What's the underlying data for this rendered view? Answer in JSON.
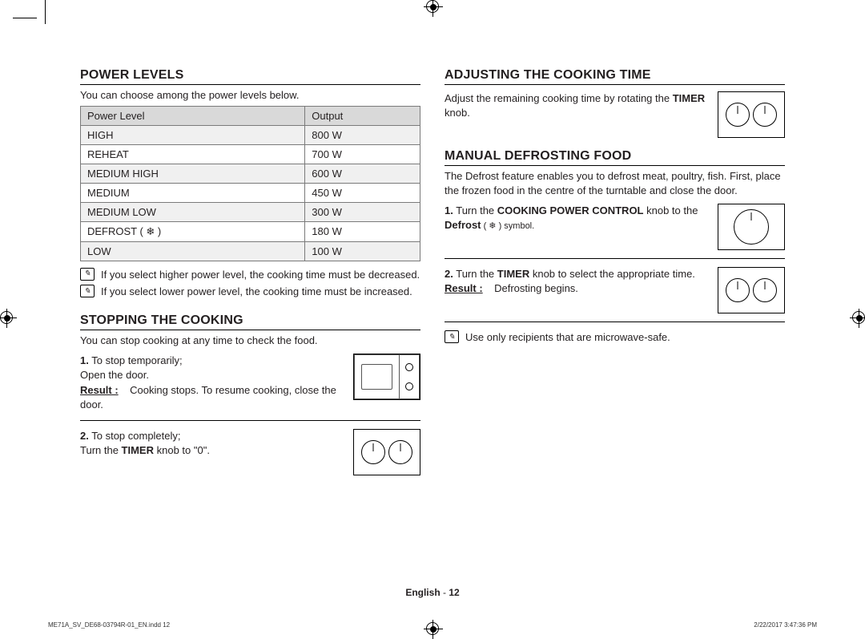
{
  "left": {
    "h_power": "POWER LEVELS",
    "power_intro": "You can choose among the power levels below.",
    "th_level": "Power Level",
    "th_output": "Output",
    "rows": [
      {
        "level": "HIGH",
        "out": "800 W"
      },
      {
        "level": "REHEAT",
        "out": "700 W"
      },
      {
        "level": "MEDIUM HIGH",
        "out": "600 W"
      },
      {
        "level": "MEDIUM",
        "out": "450 W"
      },
      {
        "level": "MEDIUM LOW",
        "out": "300 W"
      },
      {
        "level": "DEFROST ( ❄ )",
        "out": "180 W"
      },
      {
        "level": "LOW",
        "out": "100 W"
      }
    ],
    "note1": "If you select higher power level, the cooking time must be decreased.",
    "note2": "If you select lower power level, the cooking time must be increased.",
    "h_stop": "STOPPING THE COOKING",
    "stop_intro": "You can stop cooking at any time to check the food.",
    "stop1_num": "1.",
    "stop1_a": "To stop temporarily;",
    "stop1_b": "Open the door.",
    "result_label": "Result :",
    "stop1_res": "Cooking stops. To resume cooking, close the door.",
    "stop2_num": "2.",
    "stop2_a": "To stop completely;",
    "stop2_b_pre": "Turn the ",
    "stop2_b_bold": "TIMER",
    "stop2_b_post": " knob to \"0\"."
  },
  "right": {
    "h_adjust": "ADJUSTING THE COOKING TIME",
    "adjust_a": "Adjust the remaining cooking time by rotating the ",
    "adjust_bold": "TIMER",
    "adjust_b": " knob.",
    "h_defrost": "MANUAL DEFROSTING FOOD",
    "def_intro": "The Defrost feature enables you to defrost meat, poultry, fish. First, place the frozen food in the centre of the turntable and close the door.",
    "d1_num": "1.",
    "d1_a": "Turn the ",
    "d1_b1": "COOKING POWER CONTROL",
    "d1_c": " knob to the ",
    "d1_b2": "Defrost",
    "d1_d": " ( ❄ ) symbol.",
    "d2_num": "2.",
    "d2_a": "Turn the ",
    "d2_b": "TIMER",
    "d2_c": " knob to select the appropriate time.",
    "d2_res": "Defrosting begins.",
    "note": "Use only recipients that are microwave-safe."
  },
  "footer": {
    "lang": "English",
    "dash": " - ",
    "page": "12",
    "doc": "ME71A_SV_DE68-03794R-01_EN.indd   12",
    "ts": "2/22/2017   3:47:36 PM"
  }
}
